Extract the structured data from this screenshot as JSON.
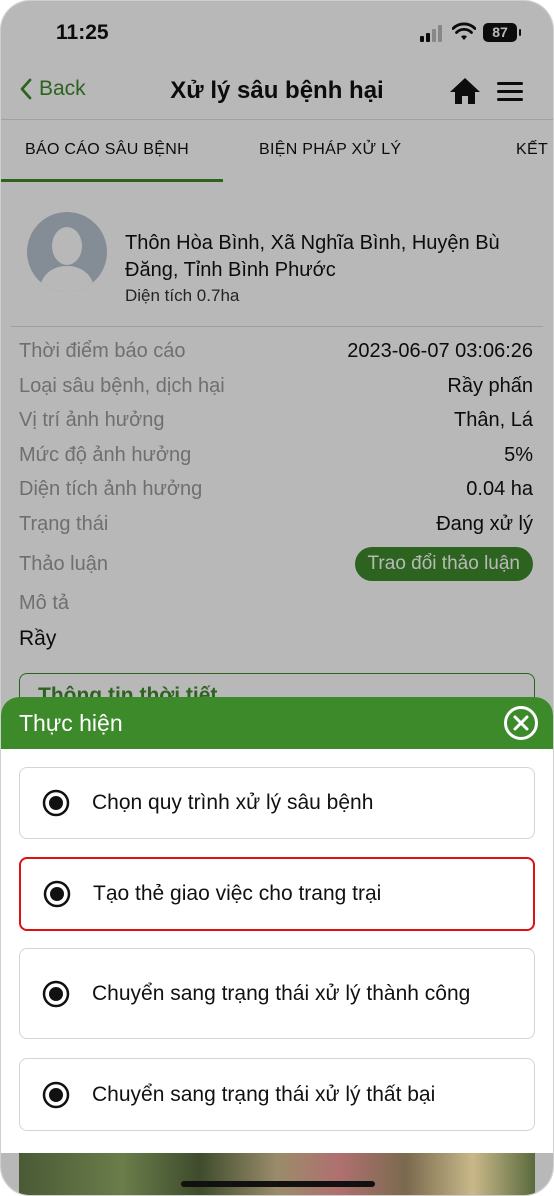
{
  "status_bar": {
    "time": "11:25",
    "battery": "87"
  },
  "nav": {
    "back_label": "Back",
    "title": "Xử lý sâu bệnh hại"
  },
  "tabs": [
    {
      "label": "BÁO CÁO SÂU BỆNH",
      "active": true
    },
    {
      "label": "BIỆN PHÁP XỬ LÝ",
      "active": false
    },
    {
      "label": "KẾT",
      "active": false
    }
  ],
  "report": {
    "address": "Thôn Hòa Bình, Xã Nghĩa Bình, Huyện Bù Đăng, Tỉnh Bình Phước",
    "area": "Diện tích 0.7ha",
    "rows": [
      {
        "label": "Thời điểm báo cáo",
        "value": "2023-06-07 03:06:26"
      },
      {
        "label": "Loại sâu bệnh, dịch hại",
        "value": "Rầy phấn"
      },
      {
        "label": "Vị trí ảnh hưởng",
        "value": "Thân, Lá"
      },
      {
        "label": "Mức độ ảnh hưởng",
        "value": "5%"
      },
      {
        "label": "Diện tích ảnh hưởng",
        "value": "0.04 ha"
      },
      {
        "label": "Trạng thái",
        "value": "Đang xử lý"
      }
    ],
    "discussion_label": "Thảo luận",
    "discussion_button": "Trao đổi thảo luận",
    "description_label": "Mô tả",
    "description_value": "Rầy",
    "weather_title": "Thông tin thời tiết"
  },
  "sheet": {
    "title": "Thực hiện",
    "options": [
      {
        "label": "Chọn quy trình xử lý sâu bệnh",
        "highlighted": false
      },
      {
        "label": "Tạo thẻ giao việc cho trang trại",
        "highlighted": true
      },
      {
        "label": "Chuyển sang trạng thái xử lý thành công",
        "highlighted": false
      },
      {
        "label": "Chuyển sang trạng thái xử lý thất bại",
        "highlighted": false
      }
    ]
  },
  "colors": {
    "accent": "#3d8a2b",
    "highlight_border": "#dd1111",
    "muted_text": "#9a9a9a"
  },
  "icons": [
    "chevron-left-icon",
    "home-icon",
    "hamburger-menu-icon",
    "close-circle-icon",
    "radio-selected-icon",
    "wifi-icon",
    "signal-icon",
    "battery-icon"
  ]
}
